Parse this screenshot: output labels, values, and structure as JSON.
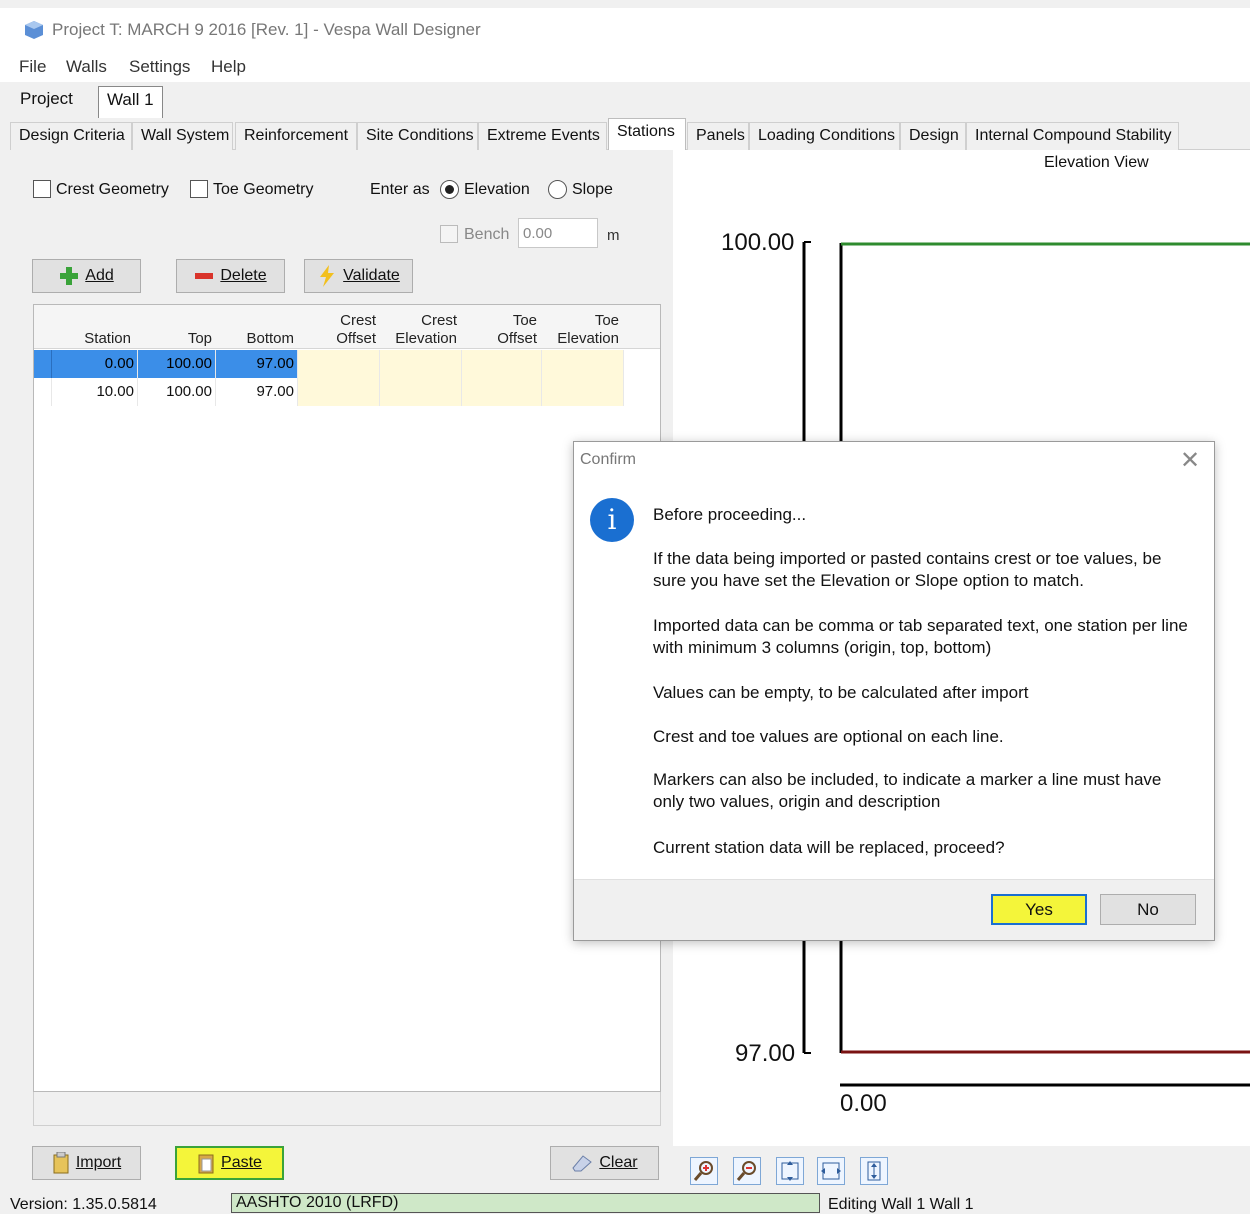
{
  "window": {
    "title": "Project T: MARCH 9 2016 [Rev. 1] - Vespa Wall Designer"
  },
  "menu": [
    "File",
    "Walls",
    "Settings",
    "Help"
  ],
  "doc_tabs": [
    "Project",
    "Wall 1"
  ],
  "page_tabs": [
    "Design Criteria",
    "Wall System",
    "Reinforcement",
    "Site Conditions",
    "Extreme Events",
    "Stations",
    "Panels",
    "Loading Conditions",
    "Design",
    "Internal Compound Stability"
  ],
  "active_page_tab": "Stations",
  "options": {
    "crest_geometry": "Crest Geometry",
    "toe_geometry": "Toe Geometry",
    "enter_as": "Enter as",
    "elevation": "Elevation",
    "slope": "Slope",
    "bench_label": "Bench",
    "bench_value": "0.00",
    "bench_unit": "m"
  },
  "buttons": {
    "add": "Add",
    "delete": "Delete",
    "validate": "Validate",
    "import": "Import",
    "paste": "Paste",
    "clear": "Clear"
  },
  "grid": {
    "headers": {
      "station": "Station",
      "top": "Top",
      "bottom": "Bottom",
      "crest_offset_1": "Crest",
      "crest_offset_2": "Offset",
      "crest_elev_1": "Crest",
      "crest_elev_2": "Elevation",
      "toe_offset_1": "Toe",
      "toe_offset_2": "Offset",
      "toe_elev_1": "Toe",
      "toe_elev_2": "Elevation"
    },
    "rows": [
      {
        "station": "0.00",
        "top": "100.00",
        "bottom": "97.00"
      },
      {
        "station": "10.00",
        "top": "100.00",
        "bottom": "97.00"
      }
    ]
  },
  "elevation_view": {
    "title": "Elevation View",
    "y_top": "100.00",
    "y_bottom": "97.00",
    "x_start": "0.00",
    "colors": {
      "top_line": "#2e8b2e",
      "bottom_line": "#7a1212"
    }
  },
  "status": {
    "version": "Version: 1.35.0.5814",
    "code": "AASHTO 2010 (LRFD)",
    "editing": "Editing Wall 1 Wall 1"
  },
  "dialog": {
    "title": "Confirm",
    "heading": "Before proceeding...",
    "p1": "If the data being imported or pasted contains crest or toe values, be sure you have set the Elevation or Slope option to match.",
    "p2": "Imported data can be comma or tab separated text, one station per line with minimum 3 columns (origin, top, bottom)",
    "p3": "Values can be empty, to be calculated after import",
    "p4": "Crest and toe values are optional on each line.",
    "p5": "Markers can also be included, to indicate a marker a line must have only two values, origin and description",
    "p6": "Current station data will be replaced, proceed?",
    "yes": "Yes",
    "no": "No"
  },
  "highlight_color": "#f4f53a"
}
